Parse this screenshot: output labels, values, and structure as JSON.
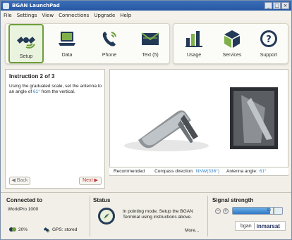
{
  "window": {
    "title": "BGAN LaunchPad",
    "controls": [
      "_",
      "□",
      "×"
    ]
  },
  "menu": [
    "File",
    "Settings",
    "View",
    "Connections",
    "Upgrade",
    "Help"
  ],
  "toolbar": {
    "items": [
      {
        "label": "Setup",
        "icon": "satellite-icon",
        "active": true
      },
      {
        "label": "Data",
        "icon": "laptop-icon"
      },
      {
        "label": "Phone",
        "icon": "phone-icon"
      },
      {
        "label": "Text (5)",
        "icon": "envelope-icon"
      },
      {
        "label": "Usage",
        "icon": "bar-chart-icon"
      },
      {
        "label": "Services",
        "icon": "cube-icon"
      },
      {
        "label": "Support",
        "icon": "question-icon"
      }
    ]
  },
  "instruction": {
    "title": "Instruction 2 of 3",
    "text_before": "Using the graduated scale, set the antenna to an angle of ",
    "angle": "61°",
    "text_after": " from the vertical.",
    "back_label": "◀ Back",
    "next_label": "Next ▶"
  },
  "recommended": {
    "label": "Recommended",
    "compass_label": "Compass direction:",
    "compass_value": "NNW(336°)",
    "angle_label": "Antenna angle:",
    "angle_value": "61°"
  },
  "connection": {
    "title": "Connected to",
    "device": "WorldPro 1000",
    "battery": "20%",
    "gps": "GPS: stored"
  },
  "status": {
    "title": "Status",
    "text": "In pointing mode. Setup the BGAN Terminal using instructions above.",
    "more": "More..."
  },
  "signal": {
    "title": "Signal strength",
    "value": "60",
    "level": 0.76,
    "threshold": 0.82,
    "brand_left": "bgan",
    "brand_right": "inmarsat"
  },
  "colors": {
    "accent_green": "#6d9d3a",
    "link_blue": "#2f7fc8",
    "icon_dark": "#233a57"
  }
}
